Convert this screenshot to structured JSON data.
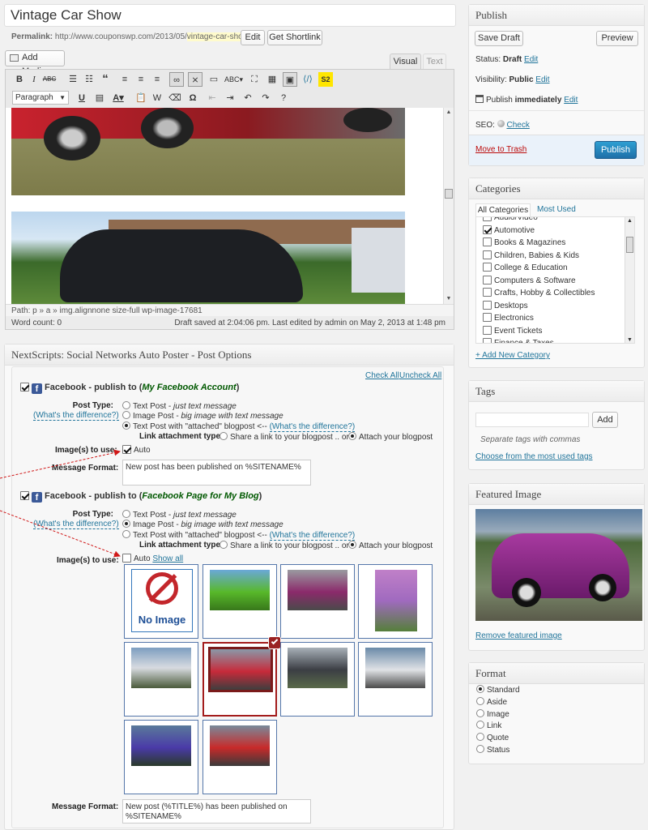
{
  "post": {
    "title": "Vintage Car Show",
    "permalink_label": "Permalink:",
    "permalink_base": "http://www.couponswp.com/2013/05/",
    "permalink_slug": "vintage-car-show",
    "permalink_end": "/",
    "edit_button": "Edit",
    "shortlink_button": "Get Shortlink"
  },
  "editor": {
    "add_media": "Add Media",
    "tab_visual": "Visual",
    "tab_text": "Text",
    "format_select": "Paragraph",
    "path": "Path: p » a » img.alignnone size-full wp-image-17681",
    "word_count": "Word count: 0",
    "draft_saved": "Draft saved at 2:04:06 pm. Last edited by admin on May 2, 2013 at 1:48 pm",
    "toolbar_icons": [
      "bold-icon",
      "italic-icon",
      "strikethrough-icon",
      "bulleted-list-icon",
      "numbered-list-icon",
      "blockquote-icon",
      "align-left-icon",
      "align-center-icon",
      "align-right-icon",
      "link-icon",
      "unlink-icon",
      "more-tag-icon",
      "spellcheck-icon",
      "fullscreen-icon",
      "kitchen-sink-icon",
      "add-image-icon",
      "shortcode-icon",
      "s2-icon",
      "underline-icon",
      "justify-icon",
      "text-color-icon",
      "paste-text-icon",
      "paste-word-icon",
      "clear-formatting-icon",
      "special-character-icon",
      "outdent-icon",
      "indent-icon",
      "undo-icon",
      "redo-icon",
      "help-icon"
    ]
  },
  "snap": {
    "title": "NextScripts: Social Networks Auto Poster - Post Options",
    "check_all": "Check All",
    "uncheck_all": "Uncheck All",
    "fb1": {
      "prefix": "Facebook - publish to (",
      "account": "My Facebook Account",
      "suffix": ")",
      "post_type_label": "Post Type:",
      "whats_difference": "(What's the difference?)",
      "opt1": "Text Post",
      "opt1_desc": "just text message",
      "opt2": "Image Post",
      "opt2_desc": "big image with text message",
      "opt3": "Text Post with \"attached\" blogpost <-- ",
      "opt3_link": "(What's the difference?)",
      "link_attach_label": "Link attachment type:",
      "share_link": "Share a link to your blogpost .. or ..",
      "attach_blog": "Attach your blogpost",
      "images_label": "Image(s) to use:",
      "auto": "Auto",
      "msg_label": "Message Format:",
      "msg_value": "New post has been published on %SITENAME%"
    },
    "fb2": {
      "prefix": "Facebook - publish to (",
      "account": "Facebook Page for My Blog",
      "suffix": ")",
      "post_type_label": "Post Type:",
      "whats_difference": "(What's the difference?)",
      "opt1": "Text Post",
      "opt1_desc": "just text message",
      "opt2": "Image Post",
      "opt2_desc": "big image with text message",
      "opt3": "Text Post with \"attached\" blogpost <-- ",
      "opt3_link": "(What's the difference?)",
      "link_attach_label": "Link attachment type:",
      "share_link": "Share a link to your blogpost .. or ..",
      "attach_blog": "Attach your blogpost",
      "images_label": "Image(s) to use:",
      "auto": "Auto",
      "show_all": "Show all",
      "no_image": "No Image",
      "msg_label": "Message Format:",
      "msg_value": "New post (%TITLE%) has been published on %SITENAME%"
    }
  },
  "publish": {
    "title": "Publish",
    "save_draft": "Save Draft",
    "preview": "Preview",
    "status_label": "Status:",
    "status_value": "Draft",
    "visibility_label": "Visibility:",
    "visibility_value": "Public",
    "publish_label": "Publish",
    "publish_value": "immediately",
    "edit": "Edit",
    "seo_label": "SEO:",
    "seo_link": "Check",
    "trash": "Move to Trash",
    "publish_button": "Publish"
  },
  "categories": {
    "title": "Categories",
    "tab_all": "All Categories",
    "tab_used": "Most Used",
    "items": [
      {
        "label": "Audio/Video",
        "checked": false
      },
      {
        "label": "Automotive",
        "checked": true
      },
      {
        "label": "Books & Magazines",
        "checked": false
      },
      {
        "label": "Children, Babies & Kids",
        "checked": false
      },
      {
        "label": "College & Education",
        "checked": false
      },
      {
        "label": "Computers & Software",
        "checked": false
      },
      {
        "label": "Crafts, Hobby & Collectibles",
        "checked": false
      },
      {
        "label": "Desktops",
        "checked": false
      },
      {
        "label": "Electronics",
        "checked": false
      },
      {
        "label": "Event Tickets",
        "checked": false
      },
      {
        "label": "Finance & Taxes",
        "checked": false
      }
    ],
    "add_new": "+ Add New Category"
  },
  "tags": {
    "title": "Tags",
    "add_button": "Add",
    "hint": "Separate tags with commas",
    "choose": "Choose from the most used tags"
  },
  "featured": {
    "title": "Featured Image",
    "remove": "Remove featured image"
  },
  "format": {
    "title": "Format",
    "options": [
      "Standard",
      "Aside",
      "Image",
      "Link",
      "Quote",
      "Status"
    ],
    "selected": "Standard"
  },
  "colors": {
    "publish_blue": "#2e8bcc",
    "link": "#21759b",
    "trash_red": "#bc0b0b",
    "fb_blue": "#3b5998",
    "account_green": "#005800"
  }
}
